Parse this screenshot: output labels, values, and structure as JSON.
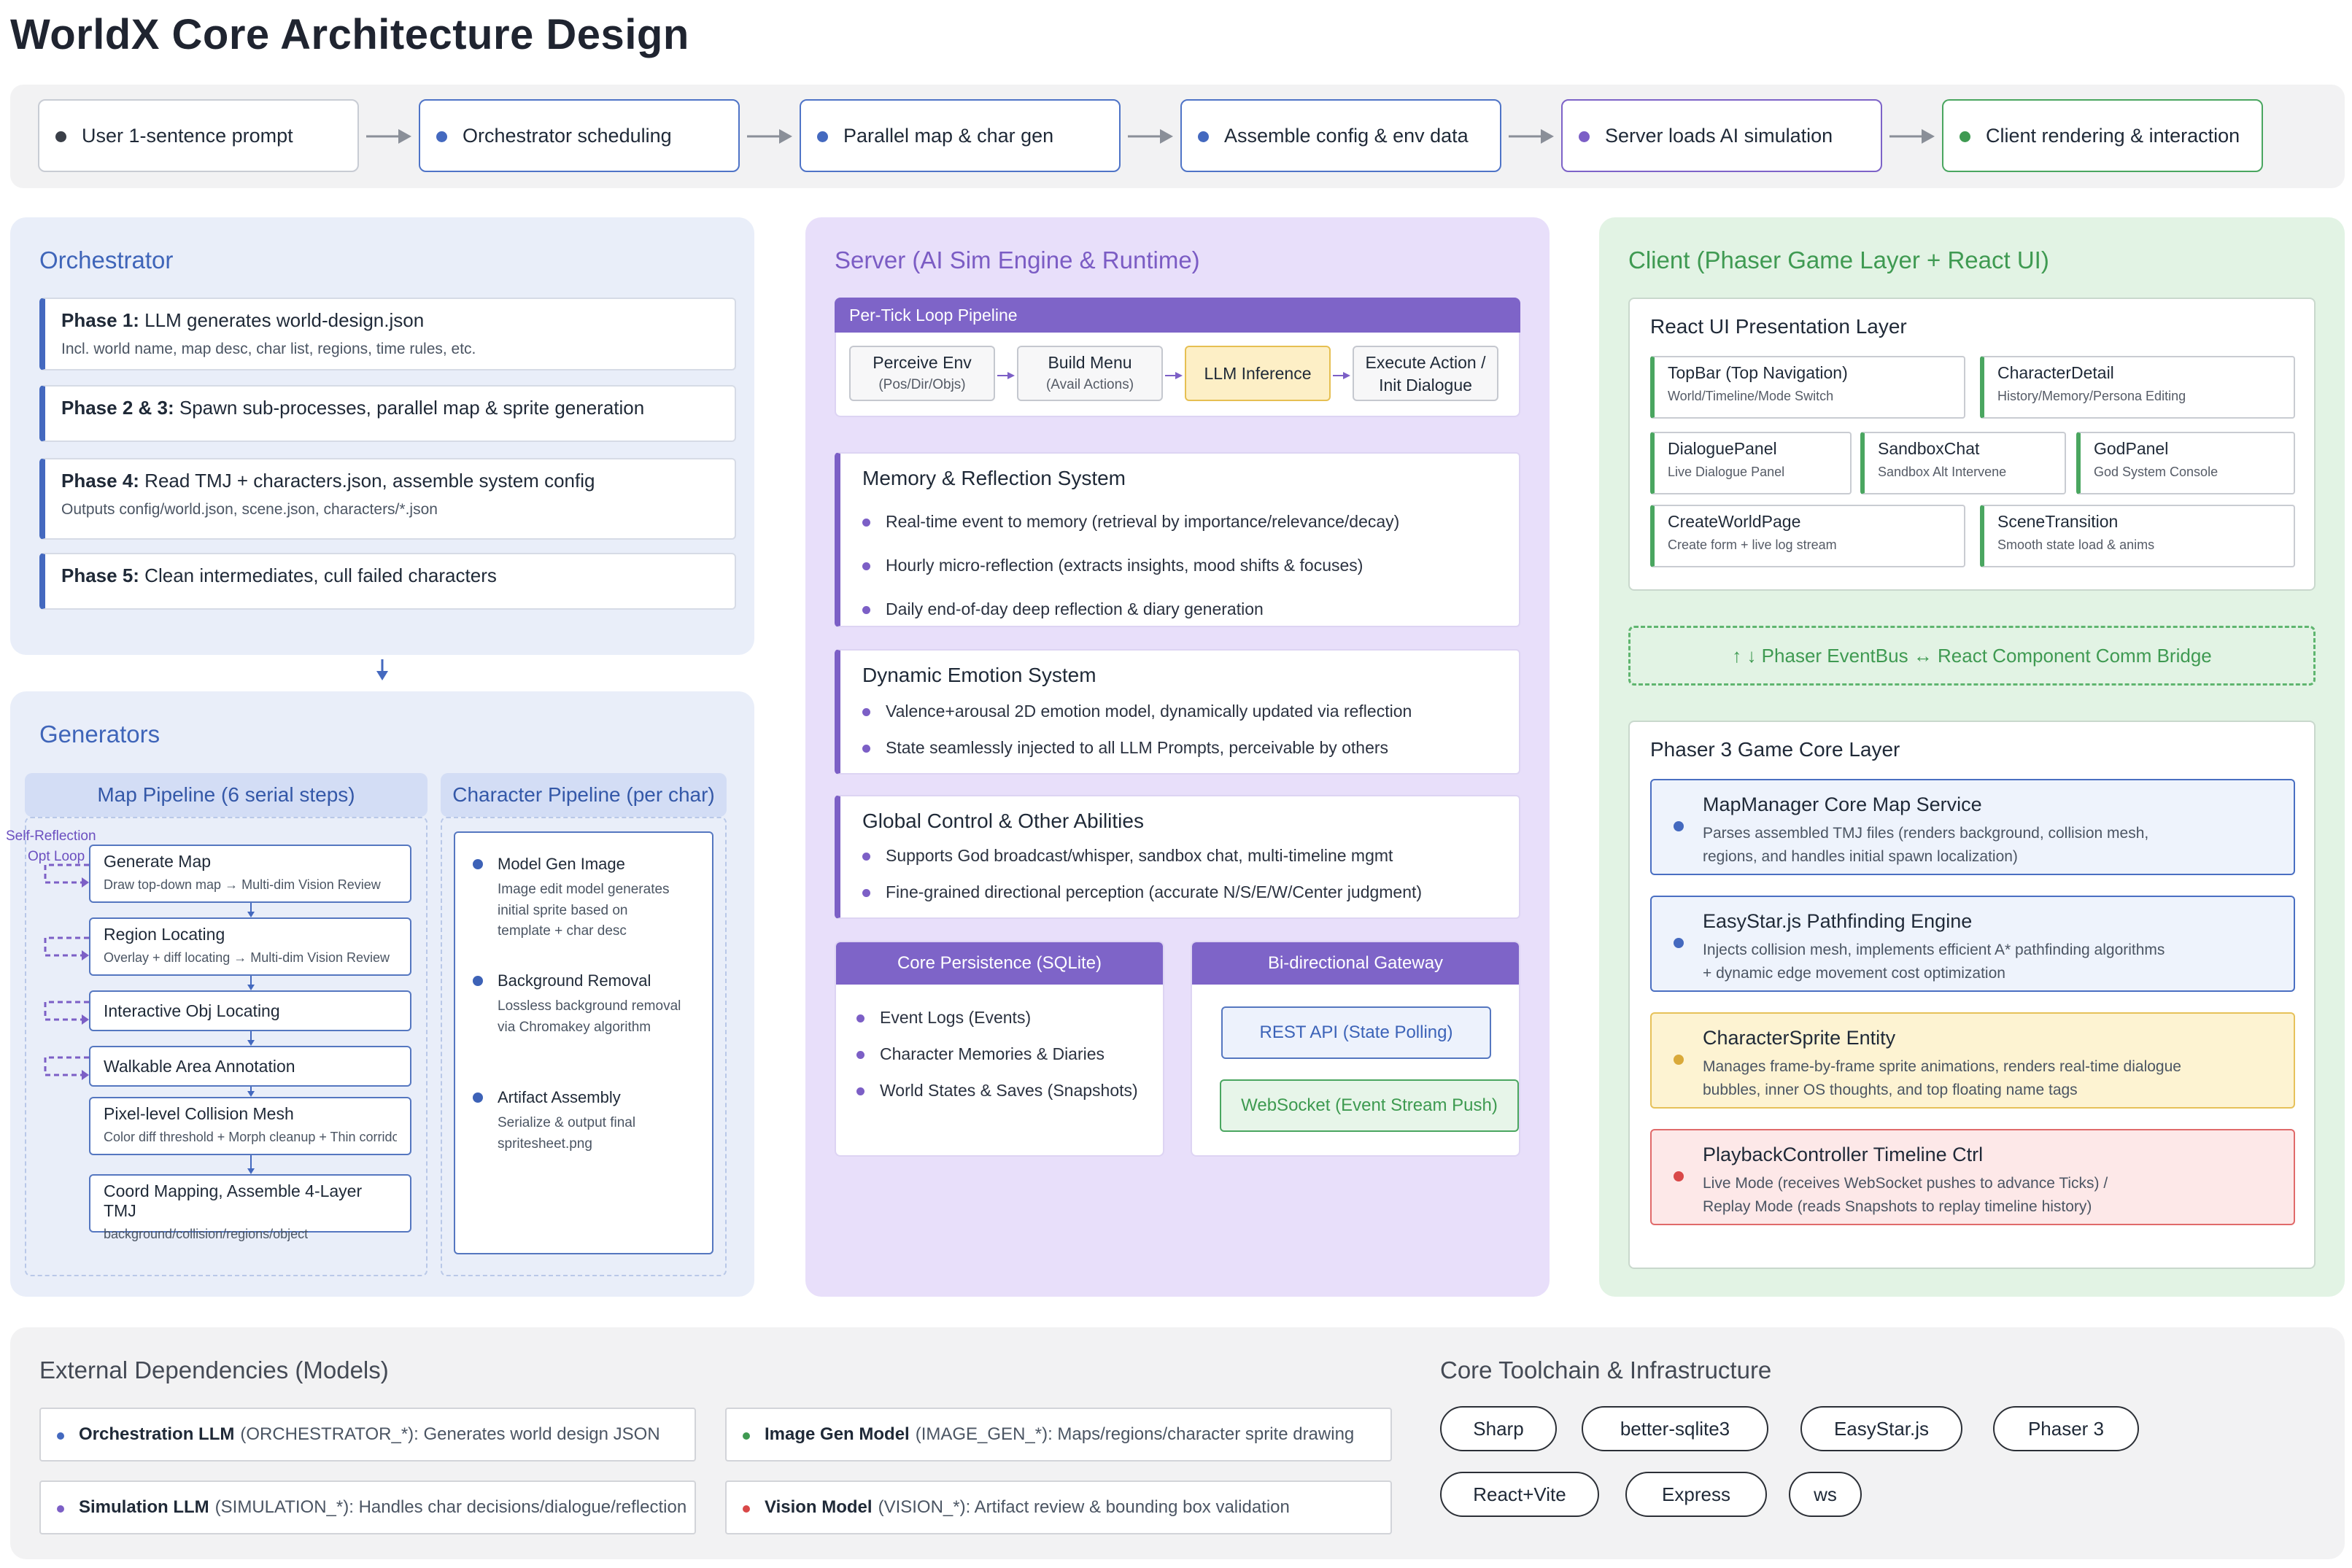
{
  "title": "WorldX Core Architecture Design",
  "flow": [
    {
      "label": "User 1-sentence prompt",
      "dot": "#3a3f48",
      "style": "gray"
    },
    {
      "label": "Orchestrator scheduling",
      "dot": "#4469bf",
      "style": "blue"
    },
    {
      "label": "Parallel map & char gen",
      "dot": "#4469bf",
      "style": "blue"
    },
    {
      "label": "Assemble config & env data",
      "dot": "#4469bf",
      "style": "blue"
    },
    {
      "label": "Server loads AI simulation",
      "dot": "#7c5fc6",
      "style": "purple"
    },
    {
      "label": "Client rendering & interaction",
      "dot": "#3f9a52",
      "style": "green"
    }
  ],
  "orchestrator": {
    "title": "Orchestrator",
    "phases": [
      {
        "bold": "Phase 1:",
        "text": " LLM generates world-design.json",
        "sub": "Incl. world name, map desc, char list, regions, time rules, etc."
      },
      {
        "bold": "Phase 2 & 3:",
        "text": " Spawn sub-processes, parallel map & sprite generation",
        "sub": ""
      },
      {
        "bold": "Phase 4:",
        "text": " Read TMJ + characters.json, assemble system config",
        "sub": "Outputs config/world.json, scene.json, characters/*.json"
      },
      {
        "bold": "Phase 5:",
        "text": " Clean intermediates, cull failed characters",
        "sub": ""
      }
    ]
  },
  "generators": {
    "title": "Generators",
    "map_pipeline": {
      "header": "Map Pipeline (6 serial steps)",
      "loop_label_1": "Self-Reflection",
      "loop_label_2": "Opt Loop",
      "steps": [
        {
          "title": "Generate Map",
          "sub": "Draw top-down map → Multi-dim Vision Review"
        },
        {
          "title": "Region Locating",
          "sub": "Overlay + diff locating → Multi-dim Vision Review"
        },
        {
          "title": "Interactive Obj Locating",
          "sub": ""
        },
        {
          "title": "Walkable Area Annotation",
          "sub": ""
        },
        {
          "title": "Pixel-level Collision Mesh",
          "sub": "Color diff threshold + Morph cleanup + Thin corridor repair"
        },
        {
          "title": "Coord Mapping, Assemble 4-Layer TMJ",
          "sub": "background/collision/regions/object"
        }
      ]
    },
    "char_pipeline": {
      "header": "Character Pipeline (per char)",
      "items": [
        {
          "title": "Model Gen Image",
          "sub": [
            "Image edit model generates",
            "initial sprite based on",
            "template + char desc"
          ]
        },
        {
          "title": "Background Removal",
          "sub": [
            "Lossless background removal",
            "via Chromakey algorithm"
          ]
        },
        {
          "title": "Artifact Assembly",
          "sub": [
            "Serialize & output final",
            "spritesheet.png"
          ]
        }
      ]
    }
  },
  "server": {
    "title": "Server (AI Sim Engine & Runtime)",
    "tick": {
      "header": "Per-Tick Loop Pipeline",
      "steps": [
        {
          "title": "Perceive Env",
          "sub": "(Pos/Dir/Objs)"
        },
        {
          "title": "Build Menu",
          "sub": "(Avail Actions)"
        },
        {
          "title": "LLM Inference",
          "sub": ""
        },
        {
          "title": "Execute Action /",
          "sub": "Init Dialogue"
        }
      ]
    },
    "memory": {
      "title": "Memory & Reflection System",
      "items": [
        "Real-time event to memory (retrieval by importance/relevance/decay)",
        "Hourly micro-reflection (extracts insights, mood shifts & focuses)",
        "Daily end-of-day deep reflection & diary generation"
      ]
    },
    "emotion": {
      "title": "Dynamic Emotion System",
      "items": [
        "Valence+arousal 2D emotion model, dynamically updated via reflection",
        "State seamlessly injected to all LLM Prompts, perceivable by others"
      ]
    },
    "global": {
      "title": "Global Control & Other Abilities",
      "items": [
        "Supports God broadcast/whisper, sandbox chat, multi-timeline mgmt",
        "Fine-grained directional perception (accurate N/S/E/W/Center judgment)"
      ]
    },
    "persistence": {
      "header": "Core Persistence (SQLite)",
      "items": [
        "Event Logs (Events)",
        "Character Memories & Diaries",
        "World States & Saves (Snapshots)"
      ]
    },
    "gateway": {
      "header": "Bi-directional Gateway",
      "rest": "REST API (State Polling)",
      "ws": "WebSocket (Event Stream Push)"
    }
  },
  "client": {
    "title": "Client (Phaser Game Layer + React UI)",
    "react": {
      "title": "React UI Presentation Layer",
      "components": [
        {
          "title": "TopBar (Top Navigation)",
          "sub": "World/Timeline/Mode Switch"
        },
        {
          "title": "CharacterDetail",
          "sub": "History/Memory/Persona Editing"
        },
        {
          "title": "DialoguePanel",
          "sub": "Live Dialogue Panel"
        },
        {
          "title": "SandboxChat",
          "sub": "Sandbox Alt Intervene"
        },
        {
          "title": "GodPanel",
          "sub": "God System Console"
        },
        {
          "title": "CreateWorldPage",
          "sub": "Create form + live log stream"
        },
        {
          "title": "SceneTransition",
          "sub": "Smooth state load & anims"
        }
      ]
    },
    "bridge": "↑ ↓ Phaser EventBus ↔ React Component Comm Bridge",
    "phaser": {
      "title": "Phaser 3 Game Core Layer",
      "cards": [
        {
          "title": "MapManager Core Map Service",
          "lines": [
            "Parses assembled TMJ files (renders background, collision mesh,",
            "regions, and handles initial spawn localization)"
          ],
          "style": "blue",
          "dot": "#4469bf"
        },
        {
          "title": "EasyStar.js Pathfinding Engine",
          "lines": [
            "Injects collision mesh, implements efficient A* pathfinding algorithms",
            "+ dynamic edge movement cost optimization"
          ],
          "style": "blue",
          "dot": "#4469bf"
        },
        {
          "title": "CharacterSprite Entity",
          "lines": [
            "Manages frame-by-frame sprite animations, renders real-time dialogue",
            "bubbles, inner OS thoughts, and top floating name tags"
          ],
          "style": "yellow",
          "dot": "#d9a93a"
        },
        {
          "title": "PlaybackController Timeline Ctrl",
          "lines": [
            "Live Mode (receives WebSocket pushes to advance Ticks) /",
            "Replay Mode (reads Snapshots to replay timeline history)"
          ],
          "style": "red",
          "dot": "#d94848"
        }
      ]
    }
  },
  "external": {
    "title": "External Dependencies (Models)",
    "models": [
      {
        "name": "Orchestration LLM",
        "desc": "(ORCHESTRATOR_*): Generates world design JSON",
        "dot": "#4469bf"
      },
      {
        "name": "Image Gen Model",
        "desc": "(IMAGE_GEN_*): Maps/regions/character sprite drawing",
        "dot": "#3f9a52"
      },
      {
        "name": "Simulation LLM",
        "desc": "(SIMULATION_*): Handles char decisions/dialogue/reflection",
        "dot": "#7c5fc6"
      },
      {
        "name": "Vision Model",
        "desc": "(VISION_*): Artifact review & bounding box validation",
        "dot": "#d94848"
      }
    ],
    "toolchain_title": "Core Toolchain & Infrastructure",
    "tools": [
      "Sharp",
      "better-sqlite3",
      "EasyStar.js",
      "Phaser 3",
      "React+Vite",
      "Express",
      "ws"
    ]
  }
}
